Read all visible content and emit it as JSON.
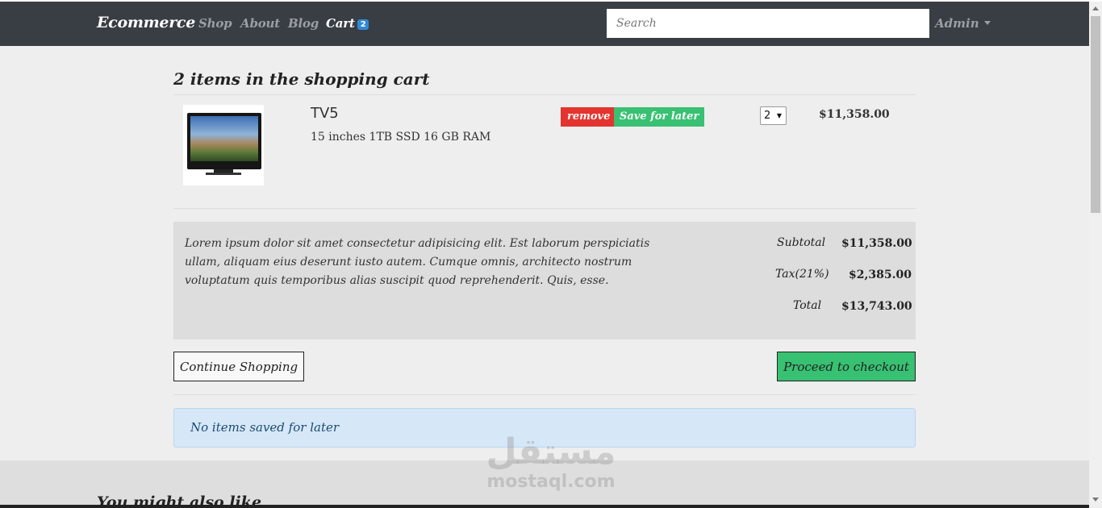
{
  "navbar": {
    "brand": "Ecommerce",
    "links": [
      "Shop",
      "About",
      "Blog"
    ],
    "cart_label": "Cart",
    "cart_count": "2",
    "search_placeholder": "Search",
    "user_menu": "Admin"
  },
  "cart": {
    "heading": "2 items in the shopping cart",
    "items": [
      {
        "name": "TV5",
        "details": "15 inches 1TB SSD 16 GB RAM",
        "remove_label": "remove",
        "save_label": "Save for later",
        "quantity": "2",
        "price": "$11,358.00"
      }
    ],
    "description": "Lorem ipsum dolor sit amet consectetur adipisicing elit. Est laborum perspiciatis ullam, aliquam eius deserunt iusto autem. Cumque omnis, architecto nostrum voluptatum quis temporibus alias suscipit quod reprehenderit. Quis, esse.",
    "subtotal_label": "Subtotal",
    "subtotal_value": "$11,358.00",
    "tax_label": "Tax(21%)",
    "tax_value": "$2,385.00",
    "total_label": "Total",
    "total_value": "$13,743.00",
    "continue_label": "Continue Shopping",
    "checkout_label": "Proceed to checkout",
    "saved_message": "No items saved for later"
  },
  "related": {
    "heading": "You might also like"
  },
  "watermark": {
    "arabic": "مستقل",
    "latin": "mostaql.com"
  },
  "colors": {
    "navbar": "#393e44",
    "remove": "#e3342f",
    "save": "#38c172",
    "checkout": "#38c172",
    "badge": "#2f89d6"
  }
}
